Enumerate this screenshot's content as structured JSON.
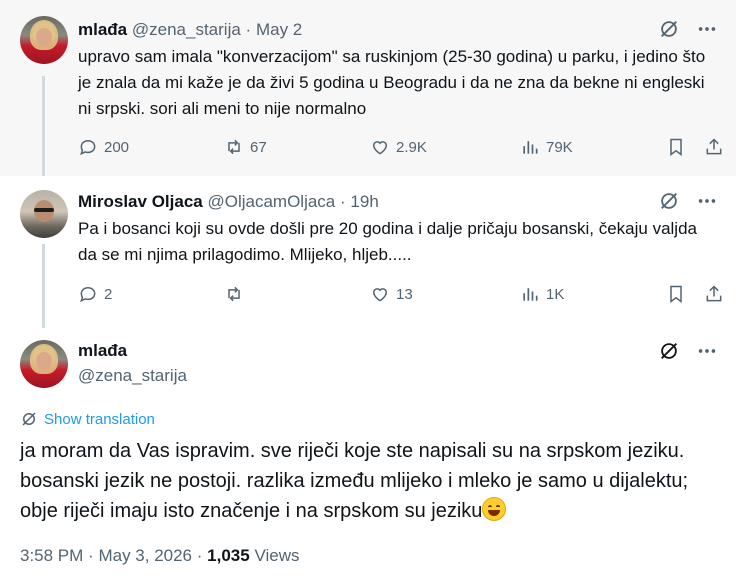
{
  "tweets": [
    {
      "name": "mlađa",
      "handle": "@zena_starija",
      "dot": "·",
      "time": "May 2",
      "text": "upravo sam imala \"konverzacijom\" sa ruskinjom (25-30 godina) u parku, i jedino što je znala da mi kaže je da živi 5 godina u Beogradu i da ne zna da bekne ni engleski ni srpski. sori ali meni to nije normalno",
      "replies": "200",
      "retweets": "67",
      "likes": "2.9K",
      "views": "79K"
    },
    {
      "name": "Miroslav Oljaca",
      "handle": "@OljacamOljaca",
      "dot": "·",
      "time": "19h",
      "text": "Pa i bosanci koji su ovde došli pre 20 godina i dalje pričaju bosanski, čekaju valjda da se mi njima prilagodimo. Mlijeko, hljeb.....",
      "replies": "2",
      "retweets": "",
      "likes": "13",
      "views": "1K"
    }
  ],
  "main": {
    "name": "mlađa",
    "handle": "@zena_starija",
    "show_translation": "Show translation",
    "text": "ja moram da Vas ispravim. sve riječi koje ste napisali su na srpskom jeziku. bosanski jezik ne postoji. razlika između mlijeko i mleko je samo u dijalektu; obje riječi imaju isto značenje i na srpskom su jeziku",
    "time": "3:58 PM",
    "dot": "·",
    "date": "May 3, 2026",
    "views_count": "1,035",
    "views_label": "Views"
  },
  "icons": {
    "grok": "grok-icon",
    "more": "more-icon",
    "reply": "reply-icon",
    "retweet": "retweet-icon",
    "like": "heart-icon",
    "views": "views-icon",
    "bookmark": "bookmark-icon",
    "share": "share-icon",
    "translate": "translate-icon",
    "emoji": "grinning-face-emoji"
  },
  "colors": {
    "text": "#0f1419",
    "muted": "#536471",
    "link": "#1d9bf0",
    "thread_line": "#cfd9de",
    "highlight_bg": "#f7f7f7"
  }
}
